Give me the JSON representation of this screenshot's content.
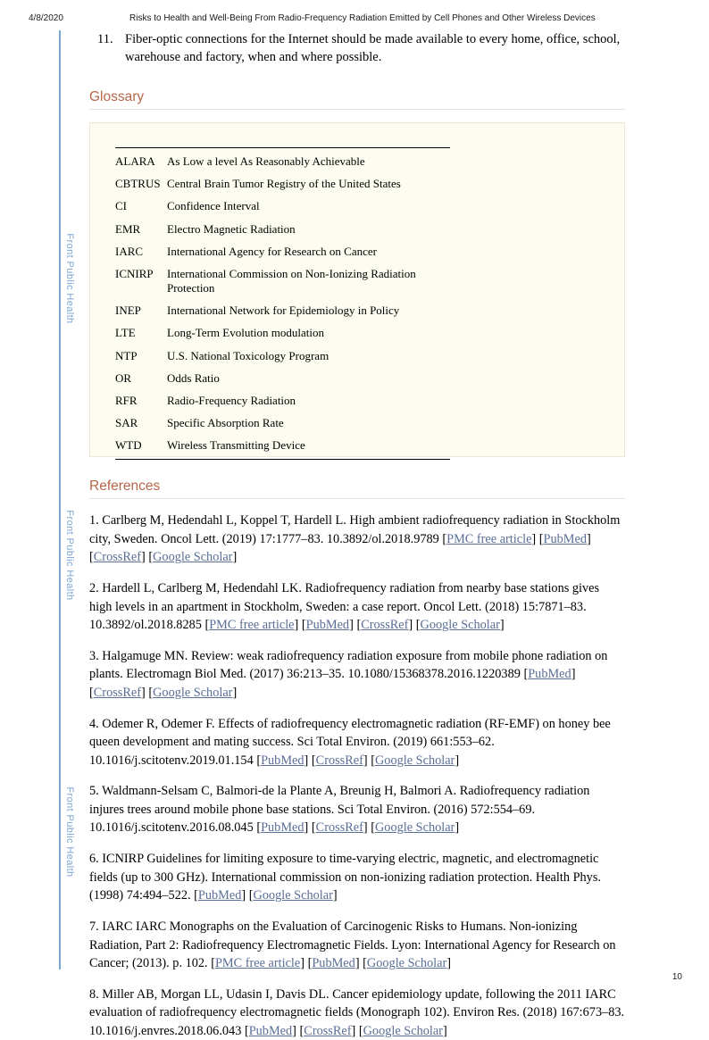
{
  "header": {
    "date": "4/8/2020",
    "title": "Risks to Health and Well-Being From Radio-Frequency Radiation Emitted by Cell Phones and Other Wireless Devices"
  },
  "sidebar": {
    "journal_label": "Front Public Health",
    "rail_color": "#7ba6d4"
  },
  "list_item": {
    "number": "11.",
    "text": "Fiber-optic connections for the Internet should be made available to every home, office, school, warehouse and factory, when and where possible."
  },
  "glossary": {
    "heading": "Glossary",
    "entries": [
      {
        "term": "ALARA",
        "definition": "As Low a level As Reasonably Achievable"
      },
      {
        "term": "CBTRUS",
        "definition": "Central Brain Tumor Registry of the United States"
      },
      {
        "term": "CI",
        "definition": "Confidence Interval"
      },
      {
        "term": "EMR",
        "definition": "Electro Magnetic Radiation"
      },
      {
        "term": "IARC",
        "definition": "International Agency for Research on Cancer"
      },
      {
        "term": "ICNIRP",
        "definition": "International Commission on Non-Ionizing Radiation Protection"
      },
      {
        "term": "INEP",
        "definition": "International Network for Epidemiology in Policy"
      },
      {
        "term": "LTE",
        "definition": "Long-Term Evolution modulation"
      },
      {
        "term": "NTP",
        "definition": "U.S. National Toxicology Program"
      },
      {
        "term": "OR",
        "definition": "Odds Ratio"
      },
      {
        "term": "RFR",
        "definition": "Radio-Frequency Radiation"
      },
      {
        "term": "SAR",
        "definition": "Specific Absorption Rate"
      },
      {
        "term": "WTD",
        "definition": "Wireless Transmitting Device"
      }
    ]
  },
  "references": {
    "heading": "References",
    "link_color": "#5a6e96",
    "items": [
      {
        "text": "1. Carlberg M, Hedendahl L, Koppel T, Hardell L. High ambient radiofrequency radiation in Stockholm city, Sweden. Oncol Lett. (2019) 17:1777–83. 10.3892/ol.2018.9789 ",
        "links": [
          "PMC free article",
          "PubMed",
          "CrossRef",
          "Google Scholar"
        ]
      },
      {
        "text": "2. Hardell L, Carlberg M, Hedendahl LK. Radiofrequency radiation from nearby base stations gives high levels in an apartment in Stockholm, Sweden: a case report. Oncol Lett. (2018) 15:7871–83. 10.3892/ol.2018.8285 ",
        "links": [
          "PMC free article",
          "PubMed",
          "CrossRef",
          "Google Scholar"
        ]
      },
      {
        "text": "3. Halgamuge MN. Review: weak radiofrequency radiation exposure from mobile phone radiation on plants. Electromagn Biol Med. (2017) 36:213–35. 10.1080/15368378.2016.1220389 ",
        "links": [
          "PubMed",
          "CrossRef",
          "Google Scholar"
        ]
      },
      {
        "text": "4. Odemer R, Odemer F. Effects of radiofrequency electromagnetic radiation (RF-EMF) on honey bee queen development and mating success. Sci Total Environ. (2019) 661:553–62. 10.1016/j.scitotenv.2019.01.154 ",
        "links": [
          "PubMed",
          "CrossRef",
          "Google Scholar"
        ]
      },
      {
        "text": "5. Waldmann-Selsam C, Balmori-de la Plante A, Breunig H, Balmori A. Radiofrequency radiation injures trees around mobile phone base stations. Sci Total Environ. (2016) 572:554–69. 10.1016/j.scitotenv.2016.08.045 ",
        "links": [
          "PubMed",
          "CrossRef",
          "Google Scholar"
        ]
      },
      {
        "text": "6. ICNIRP Guidelines for limiting exposure to time-varying electric, magnetic, and electromagnetic fields (up to 300 GHz). International commission on non-ionizing radiation protection. Health Phys. (1998) 74:494–522. ",
        "links": [
          "PubMed",
          "Google Scholar"
        ]
      },
      {
        "text": "7. IARC IARC Monographs on the Evaluation of Carcinogenic Risks to Humans. Non-ionizing Radiation, Part 2: Radiofrequency Electromagnetic Fields. Lyon: International Agency for Research on Cancer; (2013). p. 102. ",
        "links": [
          "PMC free article",
          "PubMed",
          "Google Scholar"
        ]
      },
      {
        "text": "8. Miller AB, Morgan LL, Udasin I, Davis DL. Cancer epidemiology update, following the 2011 IARC evaluation of radiofrequency electromagnetic fields (Monograph 102). Environ Res. (2018) 167:673–83. 10.1016/j.envres.2018.06.043 ",
        "links": [
          "PubMed",
          "CrossRef",
          "Google Scholar"
        ]
      }
    ]
  },
  "footer": {
    "page_number": "10"
  }
}
